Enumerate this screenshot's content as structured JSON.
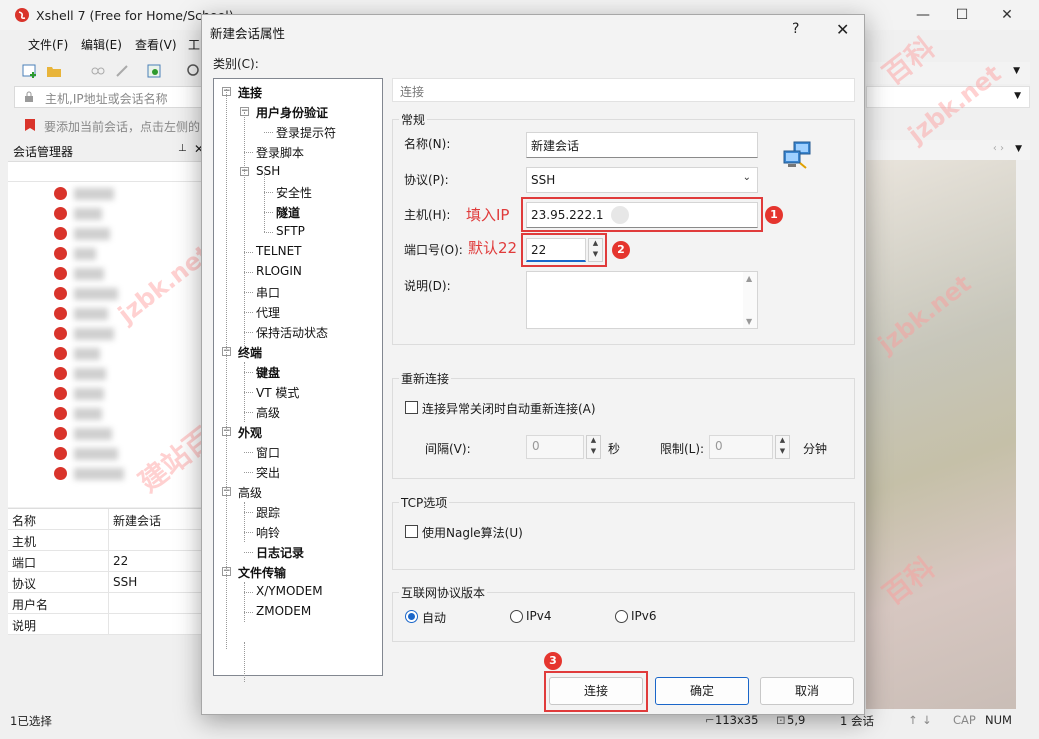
{
  "app": {
    "title": "Xshell 7 (Free for Home/School)",
    "menu": [
      "文件(F)",
      "编辑(E)",
      "查看(V)",
      "工"
    ],
    "address_placeholder": "主机,IP地址或会话名称",
    "hint": "要添加当前会话，点击左侧的",
    "session_manager": "会话管理器",
    "properties": [
      {
        "key": "名称",
        "value": "新建会话"
      },
      {
        "key": "主机",
        "value": ""
      },
      {
        "key": "端口",
        "value": "22"
      },
      {
        "key": "协议",
        "value": "SSH"
      },
      {
        "key": "用户名",
        "value": ""
      },
      {
        "key": "说明",
        "value": ""
      }
    ],
    "status": {
      "selected": "1已选择",
      "size": "113x35",
      "cursor": "5,9",
      "sessions": "1 会话",
      "cap": "CAP",
      "num": "NUM"
    },
    "watermark": [
      "百科",
      "jzbk.net",
      "建站百科"
    ]
  },
  "dialog": {
    "title": "新建会话属性",
    "help": "?",
    "close": "✕",
    "category_label": "类别(C):",
    "tree": [
      {
        "label": "连接",
        "bold": true,
        "level": 0,
        "box": "−"
      },
      {
        "label": "用户身份验证",
        "bold": true,
        "level": 1,
        "box": "−"
      },
      {
        "label": "登录提示符",
        "bold": false,
        "level": 2
      },
      {
        "label": "登录脚本",
        "bold": false,
        "level": 1
      },
      {
        "label": "SSH",
        "bold": false,
        "level": 1,
        "box": "−"
      },
      {
        "label": "安全性",
        "bold": false,
        "level": 2
      },
      {
        "label": "隧道",
        "bold": true,
        "level": 2
      },
      {
        "label": "SFTP",
        "bold": false,
        "level": 2
      },
      {
        "label": "TELNET",
        "bold": false,
        "level": 1
      },
      {
        "label": "RLOGIN",
        "bold": false,
        "level": 1
      },
      {
        "label": "串口",
        "bold": false,
        "level": 1
      },
      {
        "label": "代理",
        "bold": false,
        "level": 1
      },
      {
        "label": "保持活动状态",
        "bold": false,
        "level": 1
      },
      {
        "label": "终端",
        "bold": true,
        "level": 0,
        "box": "−"
      },
      {
        "label": "键盘",
        "bold": true,
        "level": 1
      },
      {
        "label": "VT 模式",
        "bold": false,
        "level": 1
      },
      {
        "label": "高级",
        "bold": false,
        "level": 1
      },
      {
        "label": "外观",
        "bold": true,
        "level": 0,
        "box": "−"
      },
      {
        "label": "窗口",
        "bold": false,
        "level": 1
      },
      {
        "label": "突出",
        "bold": false,
        "level": 1
      },
      {
        "label": "高级",
        "bold": false,
        "level": 0,
        "box": "−"
      },
      {
        "label": "跟踪",
        "bold": false,
        "level": 1
      },
      {
        "label": "响铃",
        "bold": false,
        "level": 1
      },
      {
        "label": "日志记录",
        "bold": true,
        "level": 1
      },
      {
        "label": "文件传输",
        "bold": true,
        "level": 0,
        "box": "−"
      },
      {
        "label": "X/YMODEM",
        "bold": false,
        "level": 1
      },
      {
        "label": "ZMODEM",
        "bold": false,
        "level": 1
      }
    ],
    "breadcrumb": "连接",
    "general": {
      "title": "常规",
      "name_label": "名称(N):",
      "name_value": "新建会话",
      "protocol_label": "协议(P):",
      "protocol_value": "SSH",
      "host_label": "主机(H):",
      "host_value": "23.95.222.1",
      "host_note": "填入IP",
      "port_label": "端口号(O):",
      "port_value": "22",
      "port_note": "默认22",
      "desc_label": "说明(D):"
    },
    "reconnect": {
      "title": "重新连接",
      "checkbox": "连接异常关闭时自动重新连接(A)",
      "interval_label": "间隔(V):",
      "interval_value": "0",
      "interval_unit": "秒",
      "limit_label": "限制(L):",
      "limit_value": "0",
      "limit_unit": "分钟"
    },
    "tcp": {
      "title": "TCP选项",
      "checkbox": "使用Nagle算法(U)"
    },
    "ipver": {
      "title": "互联网协议版本",
      "options": [
        "自动",
        "IPv4",
        "IPv6"
      ],
      "selected": "自动"
    },
    "badges": [
      "1",
      "2",
      "3"
    ],
    "buttons": {
      "connect": "连接",
      "ok": "确定",
      "cancel": "取消"
    }
  }
}
